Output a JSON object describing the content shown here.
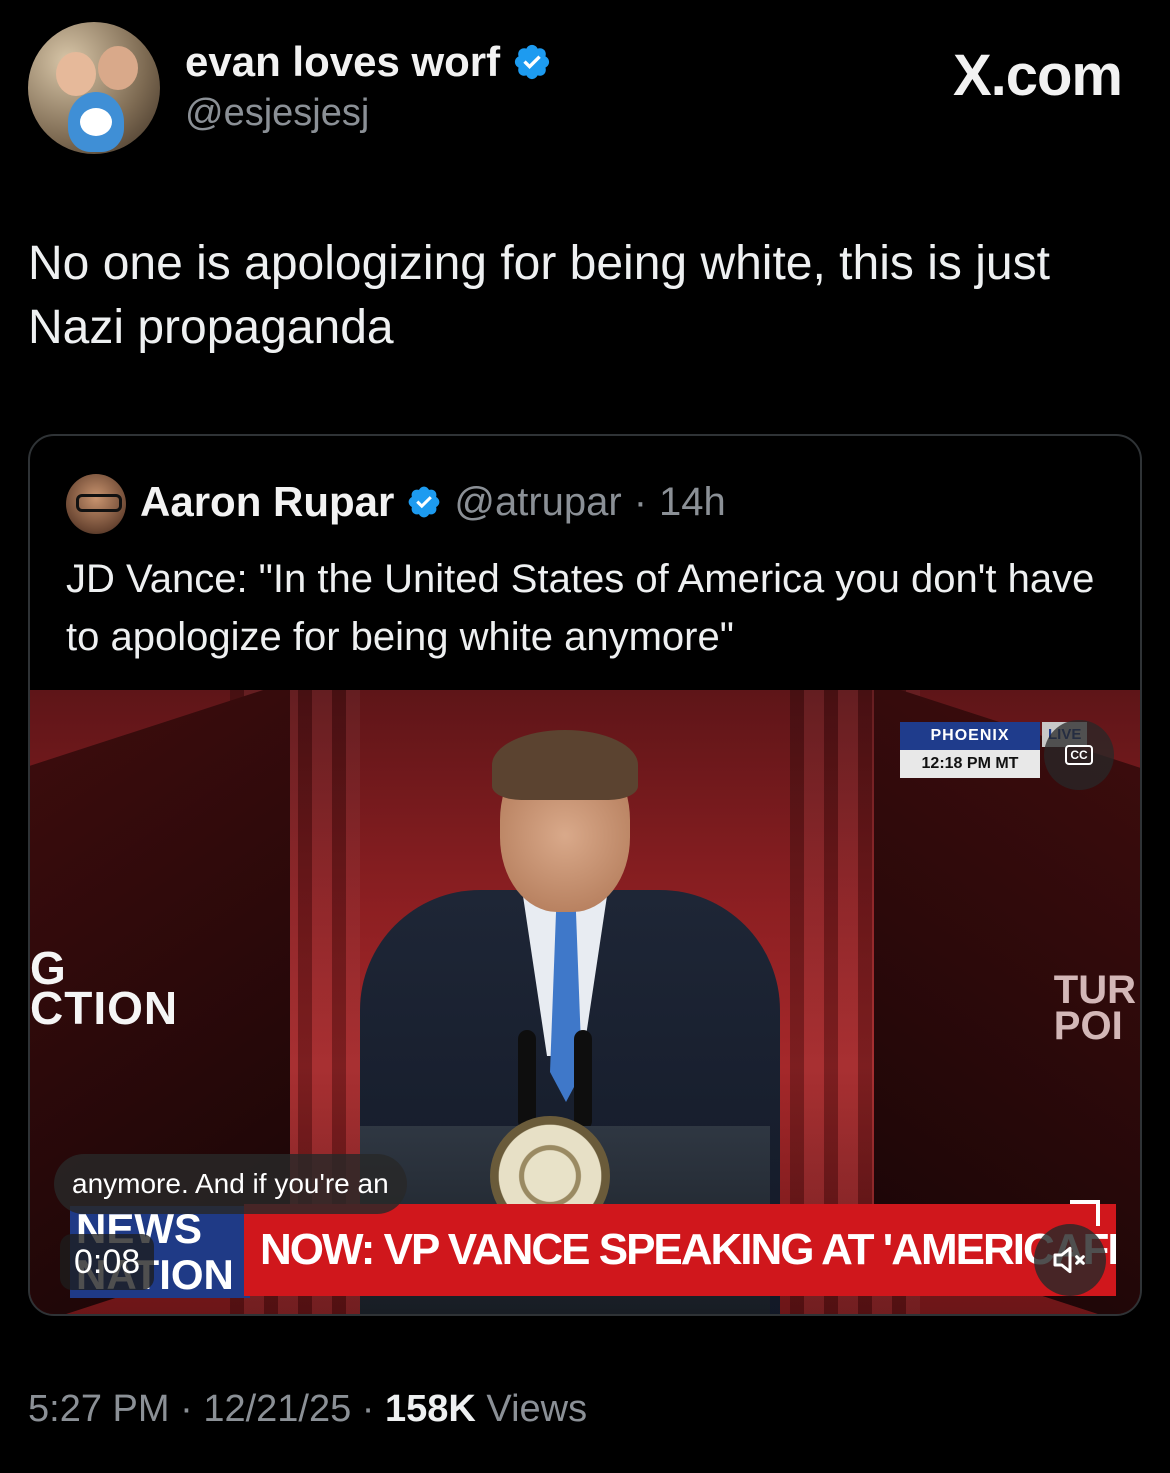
{
  "site_label": "X.com",
  "tweet": {
    "author_name": "evan loves worf",
    "author_handle": "@esjesjesj",
    "text": "No one is apologizing for being white, this is just Nazi propaganda",
    "time": "5:27 PM",
    "date": "12/21/25",
    "views_count": "158K",
    "views_label": "Views",
    "separator": " · "
  },
  "quoted": {
    "author_name": "Aaron Rupar",
    "author_handle": "@atrupar",
    "age": "14h",
    "separator": "·",
    "text": "JD Vance: \"In the United States of America you don't have to apologize for being white anymore\"",
    "video": {
      "location": "PHOENIX",
      "clock": "12:18 PM MT",
      "live_tag": "LIVE",
      "cc_label": "CC",
      "caption": "anymore. And if you're an",
      "news_logo_line1": "NEWS",
      "news_logo_line2": "NATION",
      "ticker": "NOW: VP VANCE SPEAKING AT 'AMERICAFEST'",
      "elapsed": "0:08",
      "stage_left_text": "G\nCTION",
      "stage_right_text": "TUR\nPOI"
    }
  },
  "colors": {
    "verified": "#1d9bf0",
    "muted_text": "#8b9096",
    "ticker_red": "#d0171c",
    "news_blue": "#1f3a86"
  },
  "icons": [
    "verified-badge-icon",
    "cc-icon",
    "mute-icon"
  ]
}
